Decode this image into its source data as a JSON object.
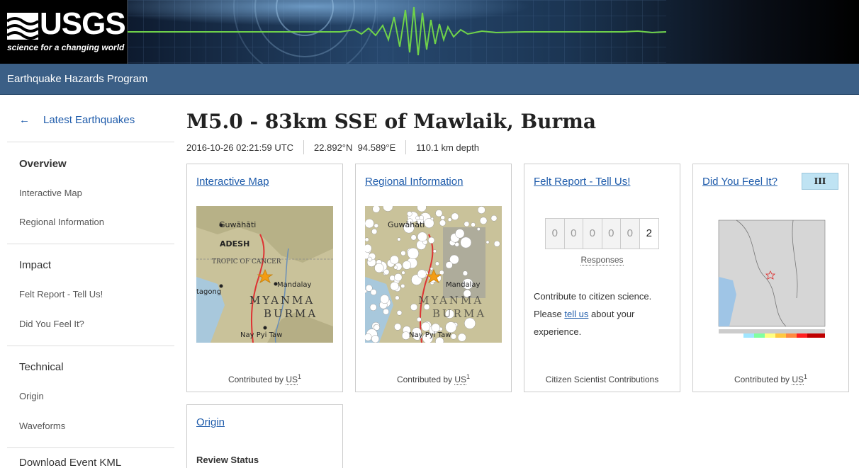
{
  "header": {
    "logo_text": "USGS",
    "logo_tagline": "science for a changing world",
    "program": "Earthquake Hazards Program"
  },
  "sidebar": {
    "back_label": "Latest Earthquakes",
    "back_icon": "arrow-left-icon",
    "sections": [
      {
        "heading": "Overview",
        "items": [
          "Interactive Map",
          "Regional Information"
        ]
      },
      {
        "heading": "Impact",
        "items": [
          "Felt Report - Tell Us!",
          "Did You Feel It?"
        ]
      },
      {
        "heading": "Technical",
        "items": [
          "Origin",
          "Waveforms"
        ]
      },
      {
        "heading": "Download Event KML",
        "items": []
      }
    ]
  },
  "event": {
    "title": "M5.0 - 83km SSE of Mawlaik, Burma",
    "time": "2016-10-26 02:21:59 UTC",
    "lat": "22.892°N",
    "lon": "94.589°E",
    "depth": "110.1 km depth"
  },
  "cards": {
    "interactive_map": {
      "title": "Interactive Map",
      "contributed_label": "Contributed by",
      "source": "US",
      "footnote": "1",
      "map_labels": {
        "city1": "Guwāhāti",
        "region": "ADESH",
        "tropic": "TROPIC OF CANCER",
        "city2": "Mandalay",
        "city3": "tagong",
        "country1": "MYANMA",
        "country2": "BURMA",
        "capital": "Nay Pyi Taw"
      }
    },
    "regional_info": {
      "title": "Regional Information",
      "contributed_label": "Contributed by",
      "source": "US",
      "footnote": "1"
    },
    "felt_report": {
      "title": "Felt Report - Tell Us!",
      "digits": [
        "0",
        "0",
        "0",
        "0",
        "0",
        "2"
      ],
      "responses_label": "Responses",
      "text_a": "Contribute to citizen science. Please ",
      "link": "tell us",
      "text_b": " about your experience.",
      "footer": "Citizen Scientist Contributions"
    },
    "dyfi": {
      "title": "Did You Feel It?",
      "intensity": "III",
      "contributed_label": "Contributed by",
      "source": "US",
      "footnote": "1"
    },
    "origin": {
      "title": "Origin",
      "review_status": "Review Status"
    }
  },
  "colors": {
    "program_bar": "#3b5f86",
    "link": "#1f5cab",
    "intensity_badge": "#bfe3f3"
  }
}
